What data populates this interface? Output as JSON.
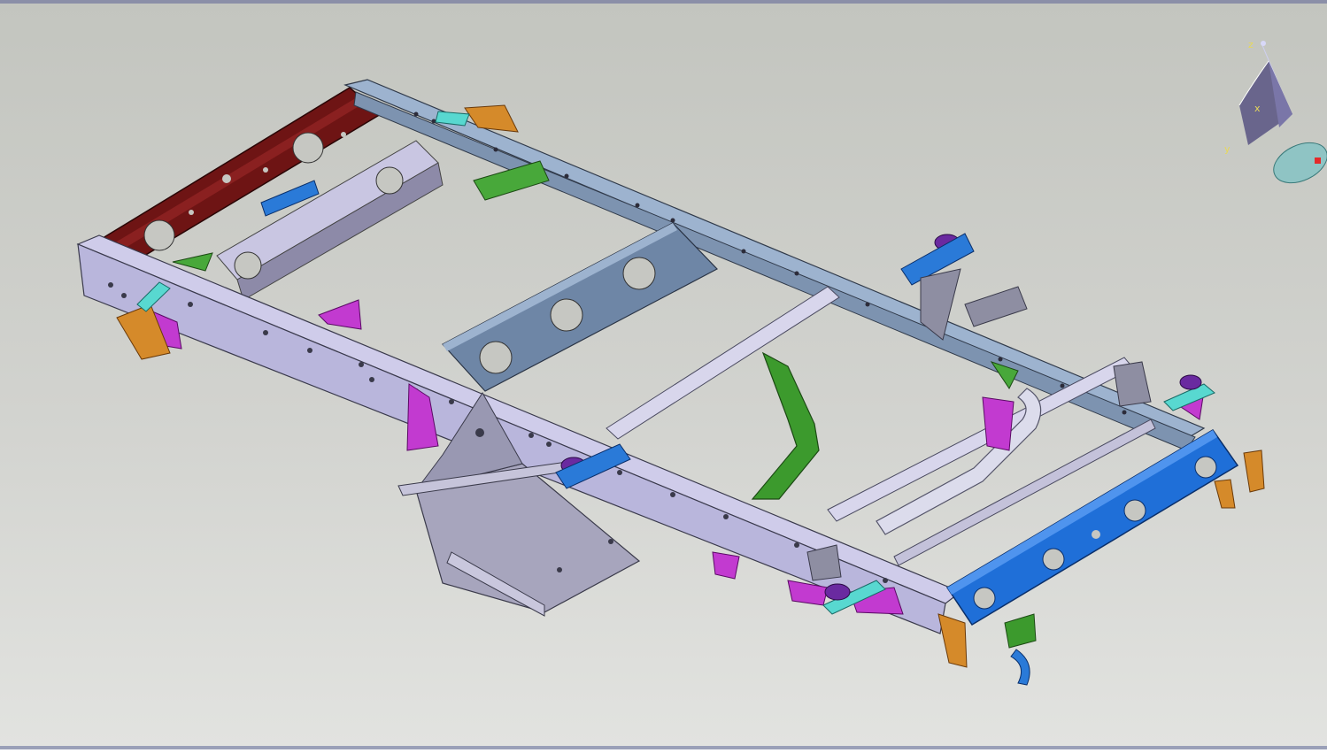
{
  "viewer": {
    "background_top": "#c3c5bf",
    "background_bottom": "#e2e3e0",
    "model": "truck-chassis-frame-assembly"
  },
  "compass": {
    "axis_z": "z",
    "axis_x": "x",
    "axis_y": "y"
  },
  "colors": {
    "side_rail": "#b9b6dc",
    "top_rail": "#9db3cf",
    "front_crossmember": "#6e1414",
    "rear_crossmember": "#1f6fd8",
    "cross_beam": "#6e86a6",
    "magenta_brackets": "#c23ad0",
    "orange_brackets": "#d58a2a",
    "green_parts": "#3c9a2d",
    "cyan_brackets": "#58d8d0"
  }
}
